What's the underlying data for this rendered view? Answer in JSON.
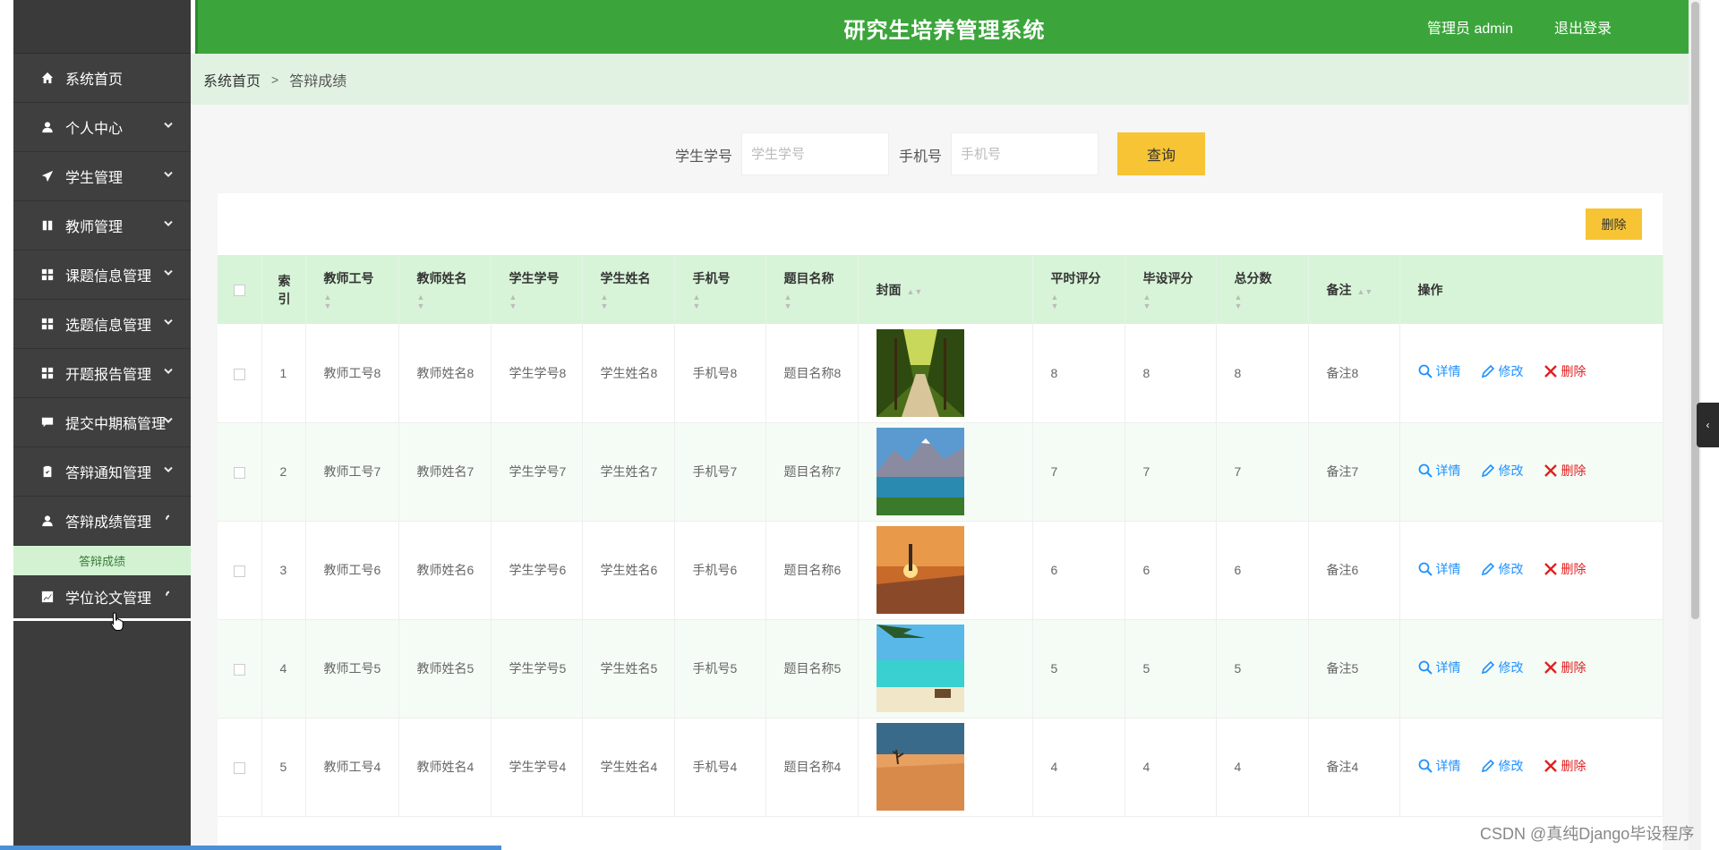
{
  "header": {
    "title": "研究生培养管理系统",
    "user_label": "管理员 admin",
    "logout_label": "退出登录",
    "bg_color": "#3ba53b"
  },
  "sidebar": {
    "items": [
      {
        "label": "系统首页",
        "icon": "home-icon",
        "has_arrow": false
      },
      {
        "label": "个人中心",
        "icon": "user-icon",
        "has_arrow": true
      },
      {
        "label": "学生管理",
        "icon": "paper-plane-icon",
        "has_arrow": true
      },
      {
        "label": "教师管理",
        "icon": "book-icon",
        "has_arrow": true
      },
      {
        "label": "课题信息管理",
        "icon": "grid-icon",
        "has_arrow": true
      },
      {
        "label": "选题信息管理",
        "icon": "grid-icon",
        "has_arrow": true
      },
      {
        "label": "开题报告管理",
        "icon": "grid-icon",
        "has_arrow": true
      },
      {
        "label": "提交中期稿管理",
        "icon": "comment-icon",
        "has_arrow": true
      },
      {
        "label": "答辩通知管理",
        "icon": "clipboard-icon",
        "has_arrow": true
      },
      {
        "label": "答辩成绩管理",
        "icon": "user-icon",
        "has_arrow": true
      },
      {
        "label": "学位论文管理",
        "icon": "chart-icon",
        "has_arrow": true
      }
    ],
    "submenu": {
      "label": "答辩成绩"
    }
  },
  "breadcrumb": {
    "home": "系统首页",
    "separator": ">",
    "current": "答辩成绩"
  },
  "search": {
    "student_id_label": "学生学号",
    "student_id_placeholder": "学生学号",
    "phone_label": "手机号",
    "phone_placeholder": "手机号",
    "query_label": "查询"
  },
  "toolbar": {
    "delete_label": "删除"
  },
  "table": {
    "headers": {
      "index": "索引",
      "teacher_id": "教师工号",
      "teacher_name": "教师姓名",
      "student_id": "学生学号",
      "student_name": "学生姓名",
      "phone": "手机号",
      "topic_name": "题目名称",
      "cover": "封面",
      "regular_score": "平时评分",
      "design_score": "毕设评分",
      "total_score": "总分数",
      "remark": "备注",
      "actions": "操作"
    },
    "actions": {
      "detail": "详情",
      "edit": "修改",
      "delete": "删除"
    },
    "rows": [
      {
        "index": "1",
        "teacher_id": "教师工号8",
        "teacher_name": "教师姓名8",
        "student_id": "学生学号8",
        "student_name": "学生姓名8",
        "phone": "手机号8",
        "topic_name": "题目名称8",
        "cover": "forest-road",
        "regular_score": "8",
        "design_score": "8",
        "total_score": "8",
        "remark": "备注8"
      },
      {
        "index": "2",
        "teacher_id": "教师工号7",
        "teacher_name": "教师姓名7",
        "student_id": "学生学号7",
        "student_name": "学生姓名7",
        "phone": "手机号7",
        "topic_name": "题目名称7",
        "cover": "mountain-lake",
        "regular_score": "7",
        "design_score": "7",
        "total_score": "7",
        "remark": "备注7"
      },
      {
        "index": "3",
        "teacher_id": "教师工号6",
        "teacher_name": "教师姓名6",
        "student_id": "学生学号6",
        "student_name": "学生姓名6",
        "phone": "手机号6",
        "topic_name": "题目名称6",
        "cover": "sunset-lighthouse",
        "regular_score": "6",
        "design_score": "6",
        "total_score": "6",
        "remark": "备注6"
      },
      {
        "index": "4",
        "teacher_id": "教师工号5",
        "teacher_name": "教师姓名5",
        "student_id": "学生学号5",
        "student_name": "学生姓名5",
        "phone": "手机号5",
        "topic_name": "题目名称5",
        "cover": "tropical-beach",
        "regular_score": "5",
        "design_score": "5",
        "total_score": "5",
        "remark": "备注5"
      },
      {
        "index": "5",
        "teacher_id": "教师工号4",
        "teacher_name": "教师姓名4",
        "student_id": "学生学号4",
        "student_name": "学生姓名4",
        "phone": "手机号4",
        "topic_name": "题目名称4",
        "cover": "desert-sunset",
        "regular_score": "4",
        "design_score": "4",
        "total_score": "4",
        "remark": "备注4"
      }
    ]
  },
  "watermark": "CSDN @真纯Django毕设程序",
  "colors": {
    "accent_yellow": "#f6c434",
    "header_green": "#3ba53b",
    "table_header_green": "#d8f4d8",
    "link_blue": "#1e90ff",
    "delete_red": "#e02020"
  }
}
